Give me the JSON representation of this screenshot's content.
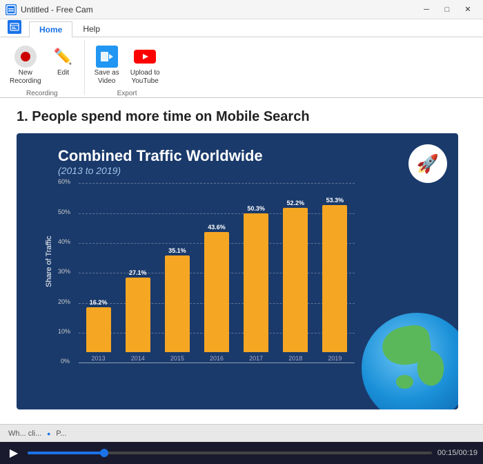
{
  "titleBar": {
    "appIcon": "■",
    "title": "Untitled - Free Cam",
    "minimizeBtn": "─",
    "maximizeBtn": "□",
    "closeBtn": "✕"
  },
  "ribbonTabs": [
    {
      "id": "home",
      "label": "Home",
      "active": true
    },
    {
      "id": "help",
      "label": "Help",
      "active": false
    }
  ],
  "ribbon": {
    "groups": [
      {
        "id": "recording",
        "label": "Recording",
        "items": [
          {
            "id": "new-recording",
            "label": "New\nRecording",
            "iconType": "record"
          },
          {
            "id": "edit",
            "label": "Edit",
            "iconType": "edit"
          }
        ]
      },
      {
        "id": "export",
        "label": "Export",
        "items": [
          {
            "id": "save-as-video",
            "label": "Save as\nVideo",
            "iconType": "video"
          },
          {
            "id": "upload-to-youtube",
            "label": "Upload to\nYouTube",
            "iconType": "youtube"
          }
        ]
      }
    ]
  },
  "content": {
    "slideTitle": "1. People spend more time on Mobile Search",
    "chart": {
      "title": "Combined Traffic Worldwide",
      "subtitle": "(2013 to 2019)",
      "yAxisLabel": "Share of Traffic",
      "bars": [
        {
          "year": "2013",
          "value": 16.2,
          "label": "16.2%"
        },
        {
          "year": "2014",
          "value": 27.1,
          "label": "27.1%"
        },
        {
          "year": "2015",
          "value": 35.1,
          "label": "35.1%"
        },
        {
          "year": "2016",
          "value": 43.6,
          "label": "43.6%"
        },
        {
          "year": "2017",
          "value": 50.3,
          "label": "50.3%"
        },
        {
          "year": "2018",
          "value": 52.2,
          "label": "52.2%"
        },
        {
          "year": "2019",
          "value": 53.3,
          "label": "53.3%"
        }
      ],
      "gridLines": [
        "60%",
        "50%",
        "40%",
        "30%",
        "20%",
        "10%",
        "0%"
      ],
      "maxValue": 60
    }
  },
  "bottomBar": {
    "playIcon": "▶",
    "currentTime": "00:15",
    "totalTime": "00:19"
  },
  "previewStrip": {
    "text1": "Wh... cli...",
    "text2": "P..."
  }
}
